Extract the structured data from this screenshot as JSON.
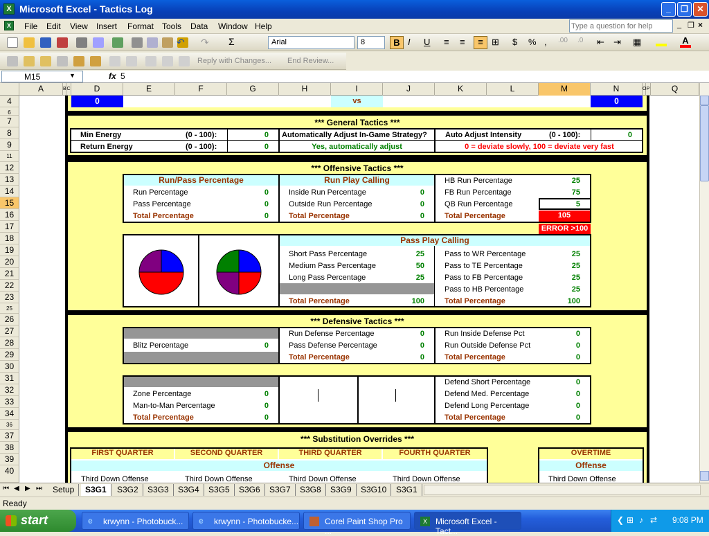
{
  "window": {
    "title": "Microsoft Excel - Tactics Log"
  },
  "menu": [
    "File",
    "Edit",
    "View",
    "Insert",
    "Format",
    "Tools",
    "Data",
    "Window",
    "Help"
  ],
  "help": {
    "placeholder": "Type a question for help"
  },
  "font": {
    "name": "Arial",
    "size": "8"
  },
  "reviewing": {
    "reply": "Reply with Changes...",
    "end": "End Review..."
  },
  "formula": {
    "cell": "M15",
    "fx": "fx",
    "value": "5"
  },
  "columns": [
    "A",
    "B",
    "C",
    "D",
    "E",
    "F",
    "G",
    "H",
    "I",
    "J",
    "K",
    "L",
    "M",
    "N",
    "O",
    "P",
    "Q"
  ],
  "rows": [
    "4",
    "6",
    "7",
    "8",
    "9",
    "11",
    "12",
    "13",
    "14",
    "15",
    "16",
    "17",
    "18",
    "19",
    "20",
    "21",
    "22",
    "23",
    "25",
    "26",
    "27",
    "28",
    "29",
    "30",
    "31",
    "32",
    "33",
    "34",
    "36",
    "37",
    "38",
    "39",
    "40"
  ],
  "scores": {
    "home": "0",
    "vs": "vs",
    "away": "0"
  },
  "general": {
    "title": "*** General Tactics ***",
    "min_energy": "Min Energy",
    "range1": "(0 - 100):",
    "min_val": "0",
    "return_energy": "Return Energy",
    "range2": "(0 - 100):",
    "return_val": "0",
    "auto_q": "Automatically Adjust In-Game Strategy?",
    "auto_a": "Yes, automatically adjust",
    "intensity": "Auto Adjust Intensity",
    "range3": "(0 - 100):",
    "intensity_val": "0",
    "note": "0 = deviate slowly, 100 = deviate very fast"
  },
  "offense": {
    "title": "*** Offensive Tactics ***",
    "runpass": {
      "header": "Run/Pass Percentage",
      "rows": [
        [
          "Run Percentage",
          "0"
        ],
        [
          "Pass Percentage",
          "0"
        ]
      ],
      "total": [
        "Total Percentage",
        "0"
      ]
    },
    "runplay": {
      "header": "Run Play Calling",
      "rows": [
        [
          "Inside Run Percentage",
          "0"
        ],
        [
          "Outside Run Percentage",
          "0"
        ]
      ],
      "total": [
        "Total Percentage",
        "0"
      ]
    },
    "runners": {
      "rows": [
        [
          "HB Run Percentage",
          "25"
        ],
        [
          "FB Run Percentage",
          "75"
        ],
        [
          "QB Run Percentage",
          "5"
        ]
      ],
      "total": [
        "Total Percentage",
        "105"
      ],
      "error": "ERROR >100"
    },
    "passplay": {
      "header": "Pass Play Calling",
      "left": [
        [
          "Short Pass Percentage",
          "25"
        ],
        [
          "Medium Pass Percentage",
          "50"
        ],
        [
          "Long Pass Percentage",
          "25"
        ]
      ],
      "left_total": [
        "Total Percentage",
        "100"
      ],
      "right": [
        [
          "Pass to WR Percentage",
          "25"
        ],
        [
          "Pass to TE Percentage",
          "25"
        ],
        [
          "Pass to FB Percentage",
          "25"
        ],
        [
          "Pass to HB Percentage",
          "25"
        ]
      ],
      "right_total": [
        "Total Percentage",
        "100"
      ]
    }
  },
  "defense": {
    "title": "*** Defensive Tactics ***",
    "blitz": [
      "Blitz Percentage",
      "0"
    ],
    "mid": [
      [
        "Run Defense Percentage",
        "0"
      ],
      [
        "Pass Defense Percentage",
        "0"
      ],
      [
        "Total Percentage",
        "0"
      ]
    ],
    "right": [
      [
        "Run Inside Defense Pct",
        "0"
      ],
      [
        "Run Outside Defense Pct",
        "0"
      ],
      [
        "Total Percentage",
        "0"
      ]
    ],
    "coverage": [
      [
        "Zone Percentage",
        "0"
      ],
      [
        "Man-to-Man Percentage",
        "0"
      ],
      [
        "Total Percentage",
        "0"
      ]
    ],
    "depth": [
      [
        "Defend Short Percentage",
        "0"
      ],
      [
        "Defend Med. Percentage",
        "0"
      ],
      [
        "Defend Long Percentage",
        "0"
      ],
      [
        "Total Percentage",
        "0"
      ]
    ]
  },
  "subs": {
    "title": "*** Substitution Overrides ***",
    "quarters": [
      "FIRST QUARTER",
      "SECOND QUARTER",
      "THIRD QUARTER",
      "FOURTH QUARTER"
    ],
    "overtime": "OVERTIME",
    "offense": "Offense",
    "third_down": "Third Down Offense"
  },
  "tabs": [
    "Setup",
    "S3G1",
    "S3G2",
    "S3G3",
    "S3G4",
    "S3G5",
    "S3G6",
    "S3G7",
    "S3G8",
    "S3G9",
    "S3G10",
    "S3G1"
  ],
  "status": "Ready",
  "taskbar": {
    "start": "start",
    "tasks": [
      "krwynn - Photobuck...",
      "krwynn - Photobucke...",
      "Corel Paint Shop Pro ...",
      "Microsoft Excel - Tact..."
    ],
    "time": "9:08 PM"
  },
  "colors": {
    "pie1": [
      "#0000ff",
      "#ff0000",
      "#800080"
    ],
    "pie2": [
      "#0000ff",
      "#ff0000",
      "#800080",
      "#008000"
    ]
  }
}
